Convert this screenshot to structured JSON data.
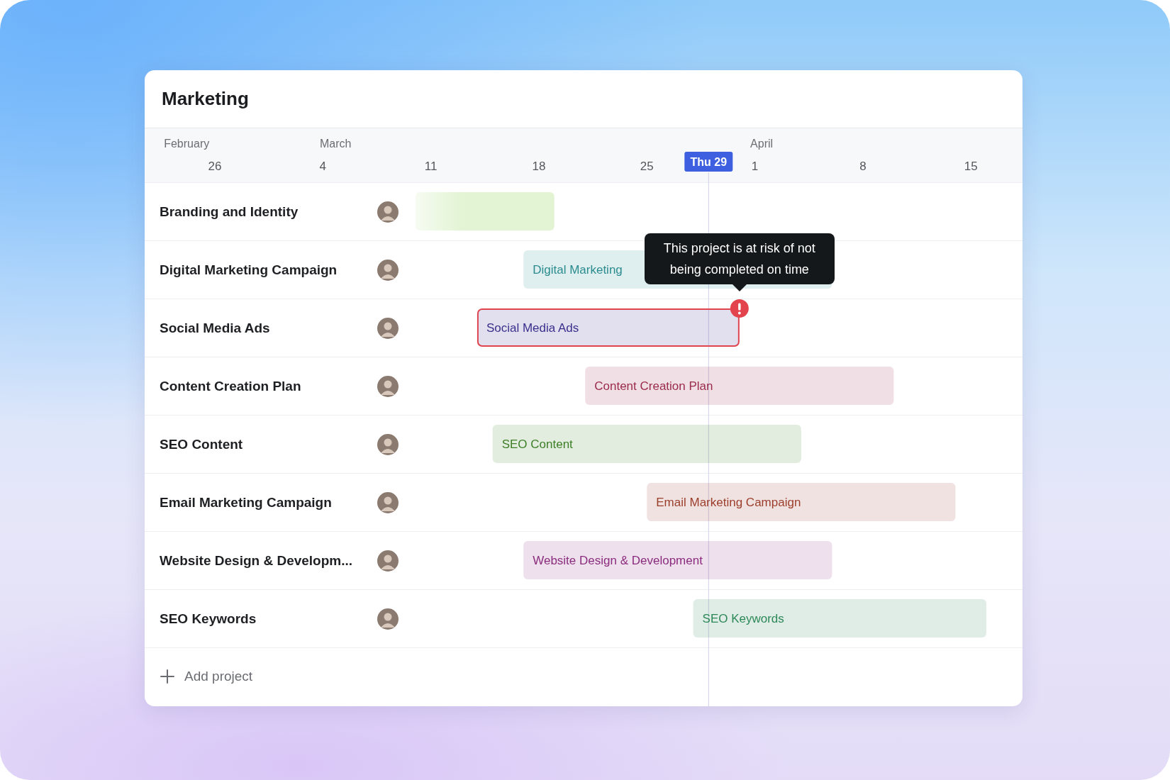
{
  "title": "Marketing",
  "timeline": {
    "months": [
      "February",
      "March",
      "April"
    ],
    "days": [
      "26",
      "4",
      "11",
      "18",
      "25",
      "1",
      "8",
      "15"
    ],
    "today": "Thu 29"
  },
  "projects": [
    {
      "name": "Branding and Identity",
      "bar": {
        "kind": "faded",
        "color": "#e2f4d3",
        "at_risk": false
      }
    },
    {
      "name": "Digital Marketing Campaign",
      "bar": {
        "kind": "labeled",
        "label": "Digital Marketing",
        "color": "#2b8c8f",
        "at_risk": false
      }
    },
    {
      "name": "Social Media Ads",
      "bar": {
        "kind": "labeled",
        "label": "Social Media Ads",
        "color": "#3a2e8c",
        "at_risk": true,
        "tooltip": "This project is at risk of not being completed on time"
      }
    },
    {
      "name": "Content Creation Plan",
      "bar": {
        "kind": "labeled",
        "label": "Content Creation Plan",
        "color": "#9a2b4c",
        "at_risk": false
      }
    },
    {
      "name": "SEO Content",
      "bar": {
        "kind": "labeled",
        "label": "SEO Content",
        "color": "#3d7f27",
        "at_risk": false
      }
    },
    {
      "name": "Email Marketing Campaign",
      "bar": {
        "kind": "labeled",
        "label": "Email Marketing Campaign",
        "color": "#9c3e2c",
        "at_risk": false
      }
    },
    {
      "name": "Website Design & Developm...",
      "bar": {
        "kind": "labeled",
        "label": "Website Design & Development",
        "color": "#8b2d7e",
        "at_risk": false
      }
    },
    {
      "name": "SEO Keywords",
      "bar": {
        "kind": "labeled",
        "label": "SEO Keywords",
        "color": "#2c8858",
        "at_risk": false
      }
    }
  ],
  "add_button": "Add project"
}
